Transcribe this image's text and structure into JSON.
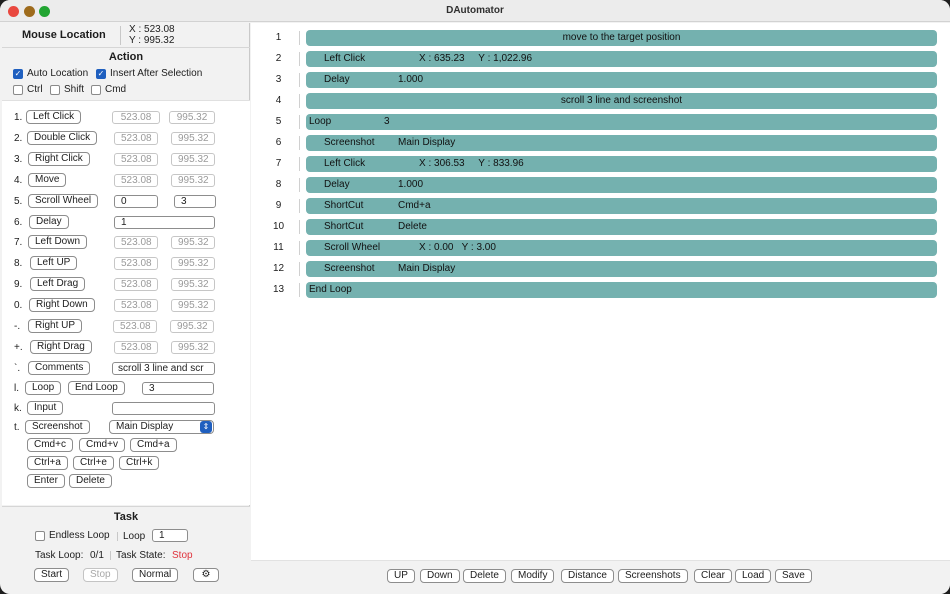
{
  "window": {
    "title": "DAutomator"
  },
  "mouse_location": {
    "label": "Mouse Location",
    "x": "X : 523.08",
    "y": "Y : 995.32"
  },
  "action": {
    "title": "Action",
    "options": [
      {
        "label": "Auto Location",
        "checked": true
      },
      {
        "label": "Insert After Selection",
        "checked": true
      },
      {
        "label": "Ctrl",
        "checked": false
      },
      {
        "label": "Shift",
        "checked": false
      },
      {
        "label": "Cmd",
        "checked": false
      }
    ],
    "rows": [
      {
        "key": "1.",
        "label": "Left Click",
        "x": "523.08",
        "y": "995.32"
      },
      {
        "key": "2.",
        "label": "Double Click",
        "x": "523.08",
        "y": "995.32"
      },
      {
        "key": "3.",
        "label": "Right Click",
        "x": "523.08",
        "y": "995.32"
      },
      {
        "key": "4.",
        "label": "Move",
        "x": "523.08",
        "y": "995.32"
      },
      {
        "key": "5.",
        "label": "Scroll Wheel",
        "x": "0",
        "y": "3"
      },
      {
        "key": "6.",
        "label": "Delay",
        "value": "1"
      },
      {
        "key": "7.",
        "label": "Left Down",
        "x": "523.08",
        "y": "995.32"
      },
      {
        "key": "8.",
        "label": "Left UP",
        "x": "523.08",
        "y": "995.32"
      },
      {
        "key": "9.",
        "label": "Left Drag",
        "x": "523.08",
        "y": "995.32"
      },
      {
        "key": "0.",
        "label": "Right Down",
        "x": "523.08",
        "y": "995.32"
      },
      {
        "key": "-.",
        "label": "Right UP",
        "x": "523.08",
        "y": "995.32"
      },
      {
        "key": "+.",
        "label": "Right Drag",
        "x": "523.08",
        "y": "995.32"
      },
      {
        "key": "`.",
        "label": "Comments",
        "value": "scroll 3 line and scr"
      }
    ],
    "loop": {
      "key": "l.",
      "loop_label": "Loop",
      "end_loop_label": "End Loop",
      "value": "3"
    },
    "input": {
      "key": "k.",
      "label": "Input",
      "value": ""
    },
    "screenshot": {
      "key": "t.",
      "label": "Screenshot",
      "selected": "Main Display"
    },
    "shortcuts": [
      "Cmd+c",
      "Cmd+v",
      "Cmd+a",
      "Ctrl+a",
      "Ctrl+e",
      "Ctrl+k",
      "Enter",
      "Delete"
    ]
  },
  "task": {
    "title": "Task",
    "endless_loop_label": "Endless Loop",
    "endless_loop_checked": false,
    "loop_label": "Loop",
    "loop_value": "1",
    "task_loop_label": "Task Loop:",
    "task_loop_value": "0/1",
    "task_state_label": "Task State:",
    "task_state_value": "Stop",
    "buttons": {
      "start": "Start",
      "stop": "Stop",
      "normal": "Normal"
    }
  },
  "steps": [
    {
      "n": "1",
      "type": "comment",
      "text": "move to the target position"
    },
    {
      "n": "2",
      "type": "action",
      "name": "Left Click",
      "detail": "X : 635.23     Y : 1,022.96",
      "offset": "xy"
    },
    {
      "n": "3",
      "type": "action",
      "name": "Delay",
      "detail": "1.000"
    },
    {
      "n": "4",
      "type": "comment",
      "text": "scroll 3 line and screenshot"
    },
    {
      "n": "5",
      "type": "loop",
      "name": "Loop",
      "detail": "3"
    },
    {
      "n": "6",
      "type": "action",
      "name": "Screenshot",
      "detail": "Main Display"
    },
    {
      "n": "7",
      "type": "action",
      "name": "Left Click",
      "detail": "X : 306.53     Y : 833.96",
      "offset": "xy"
    },
    {
      "n": "8",
      "type": "action",
      "name": "Delay",
      "detail": "1.000"
    },
    {
      "n": "9",
      "type": "action",
      "name": "ShortCut",
      "detail": "Cmd+a"
    },
    {
      "n": "10",
      "type": "action",
      "name": "ShortCut",
      "detail": "Delete"
    },
    {
      "n": "11",
      "type": "action",
      "name": "Scroll Wheel",
      "detail": "X : 0.00   Y : 3.00",
      "offset": "xy"
    },
    {
      "n": "12",
      "type": "action",
      "name": "Screenshot",
      "detail": "Main Display"
    },
    {
      "n": "13",
      "type": "loop",
      "name": "End Loop",
      "detail": ""
    }
  ],
  "toolbar": [
    "UP",
    "Down",
    "Delete",
    "Modify",
    "Distance",
    "Screenshots",
    "Clear",
    "Load",
    "Save"
  ],
  "colors": {
    "step_pill": "#74b1af",
    "checkbox_accent": "#1f5fbf",
    "task_state_stop": "#e0333d"
  }
}
